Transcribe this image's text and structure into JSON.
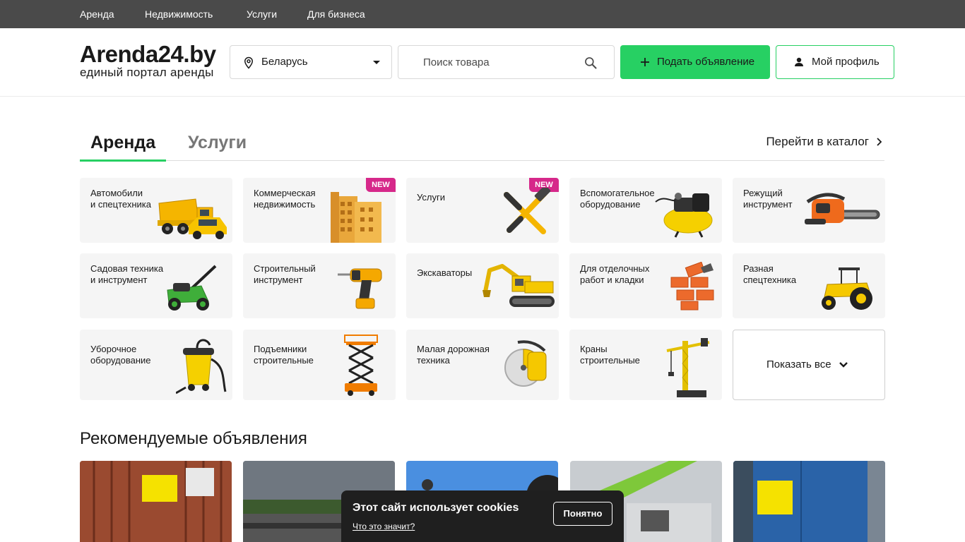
{
  "topnav": {
    "items": [
      "Аренда",
      "Недвижимость",
      "Услуги",
      "Для бизнеса"
    ]
  },
  "header": {
    "logo_title": "Arenda24.by",
    "logo_subtitle": "единый портал аренды",
    "region_value": "Беларусь",
    "search_placeholder": "Поиск товара",
    "post_button": "Подать объявление",
    "profile_button": "Мой профиль"
  },
  "tabs": {
    "items": [
      "Аренда",
      "Услуги"
    ],
    "active": "Аренда",
    "catalog_link": "Перейти в каталог"
  },
  "categories": [
    {
      "label": "Автомобили\nи спецтехника",
      "icon": "dump-truck-icon"
    },
    {
      "label": "Коммерческая\nнедвижимость",
      "icon": "building-icon",
      "badge": "NEW"
    },
    {
      "label": "Услуги",
      "icon": "hammer-wrench-icon",
      "badge": "NEW"
    },
    {
      "label": "Вспомогательное\nоборудование",
      "icon": "compressor-icon"
    },
    {
      "label": "Режущий\nинструмент",
      "icon": "chainsaw-icon"
    },
    {
      "label": "Садовая техника\nи инструмент",
      "icon": "lawn-mower-icon"
    },
    {
      "label": "Строительный\nинструмент",
      "icon": "drill-icon"
    },
    {
      "label": "Экскаваторы",
      "icon": "excavator-icon"
    },
    {
      "label": "Для отделочных\nработ и кладки",
      "icon": "bricks-icon"
    },
    {
      "label": "Разная\nспецтехника",
      "icon": "tractor-icon"
    },
    {
      "label": "Уборочное\nоборудование",
      "icon": "vacuum-cleaner-icon"
    },
    {
      "label": "Подъемники\nстроительные",
      "icon": "scissor-lift-icon"
    },
    {
      "label": "Малая дорожная\nтехника",
      "icon": "concrete-saw-icon"
    },
    {
      "label": "Краны\nстроительные",
      "icon": "tower-crane-icon"
    }
  ],
  "show_all": "Показать все",
  "recommended": {
    "title": "Рекомендуемые объявления"
  },
  "cookie": {
    "title": "Этот сайт использует cookies",
    "link": "Что это значит?",
    "button": "Понятно"
  },
  "colors": {
    "accent": "#27d063",
    "badge": "#d6288a",
    "topnav": "#4a4a4a",
    "tile_bg": "#f5f5f5"
  }
}
